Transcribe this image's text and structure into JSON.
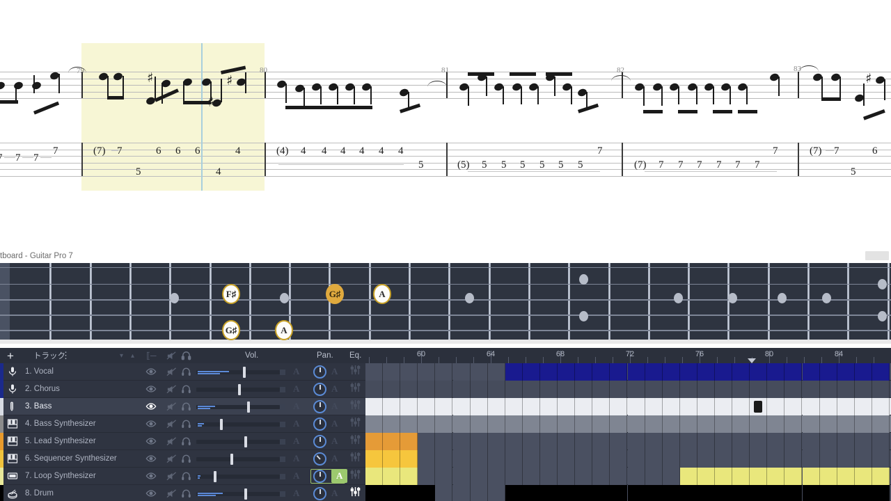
{
  "window": {
    "title": "tboard - Guitar Pro 7"
  },
  "score": {
    "measures": [
      {
        "number": "79",
        "tab_top": [
          "(7)",
          "7",
          "6",
          "6",
          "6",
          "4"
        ],
        "tab_low": [
          "5",
          "4"
        ],
        "selected": true
      },
      {
        "number": "80",
        "tab_top": [
          "(4)",
          "4",
          "4",
          "4",
          "4",
          "4",
          "4"
        ],
        "tab_low": [
          "5"
        ],
        "selected": false
      },
      {
        "number": "81",
        "tab_top": [
          "(5)",
          "5",
          "5",
          "5",
          "5",
          "5",
          "5",
          "7"
        ],
        "tab_low": [],
        "selected": false
      },
      {
        "number": "82",
        "tab_top": [
          "(7)",
          "7",
          "7",
          "7",
          "7",
          "7",
          "7",
          "7"
        ],
        "tab_low": [],
        "selected": false
      },
      {
        "number": "83",
        "tab_top": [
          "(7)",
          "7",
          "6"
        ],
        "tab_low": [
          "5"
        ],
        "selected": false
      }
    ],
    "partial_left_tab": [
      "7",
      "7",
      "7",
      "7"
    ]
  },
  "fretboard": {
    "notes": [
      {
        "label": "F♯",
        "style": "plain"
      },
      {
        "label": "G♯",
        "style": "root"
      },
      {
        "label": "A",
        "style": "plain"
      },
      {
        "label": "G♯",
        "style": "plain"
      },
      {
        "label": "A",
        "style": "plain"
      }
    ]
  },
  "track_panel": {
    "add_label": "+",
    "header_label": "トラック",
    "menu_icon": "kebab-menu-icon",
    "columns": {
      "vol": "Vol.",
      "pan": "Pan.",
      "eq": "Eq."
    },
    "tracks": [
      {
        "name": "1. Vocal",
        "icon": "microphone-icon",
        "color": "#1b2a8c",
        "selected": false,
        "vol": 0.6,
        "meter": 0.4,
        "pan_active": false,
        "eq_bright": false
      },
      {
        "name": "2. Chorus",
        "icon": "microphone-icon",
        "color": "#1b2a8c",
        "selected": false,
        "vol": 0.54,
        "meter": 0.0,
        "pan_active": false,
        "eq_bright": false
      },
      {
        "name": "3. Bass",
        "icon": "bass-guitar-icon",
        "color": "#d8dce4",
        "selected": true,
        "vol": 0.65,
        "meter": 0.22,
        "pan_active": false,
        "eq_bright": false
      },
      {
        "name": "4. Bass Synthesizer",
        "icon": "synth-icon",
        "color": "#8b8b8b",
        "selected": false,
        "vol": 0.3,
        "meter": 0.08,
        "pan_active": false,
        "eq_bright": false
      },
      {
        "name": "5. Lead Synthesizer",
        "icon": "synth-icon",
        "color": "#e89a2c",
        "selected": false,
        "vol": 0.62,
        "meter": 0.0,
        "pan_active": false,
        "eq_bright": false
      },
      {
        "name": "6. Sequencer Synthesizer",
        "icon": "synth-icon",
        "color": "#f0c33c",
        "selected": false,
        "vol": 0.44,
        "meter": 0.0,
        "pan_active": false,
        "eq_bright": false
      },
      {
        "name": "7. Loop Synthesizer",
        "icon": "loop-box-icon",
        "color": "#e8e89a",
        "selected": false,
        "vol": 0.22,
        "meter": 0.04,
        "pan_active": true,
        "eq_bright": false
      },
      {
        "name": "8. Drum",
        "icon": "drum-icon",
        "color": "#000000",
        "selected": false,
        "vol": 0.62,
        "meter": 0.32,
        "pan_active": false,
        "eq_bright": true
      }
    ],
    "automation_label": "A"
  },
  "timeline": {
    "ruler_numbers": [
      "60",
      "64",
      "68",
      "72",
      "76",
      "80",
      "84"
    ],
    "playhead_measure": "79",
    "lanes": [
      {
        "track": "1. Vocal",
        "clip_color": "#191a8f",
        "empty_color": "#4a5061",
        "clips": [
          {
            "start": 8,
            "end": 30
          }
        ]
      },
      {
        "track": "2. Chorus",
        "clip_color": "#4a5061",
        "empty_color": "#464c5c",
        "clips": []
      },
      {
        "track": "3. Bass",
        "clip_color": "#ebedf2",
        "empty_color": "#ebedf2",
        "clips": [
          {
            "start": 0,
            "end": 30
          }
        ],
        "marker_at": 22
      },
      {
        "track": "4. Bass Synthesizer",
        "clip_color": "#7f8592",
        "empty_color": "#7f8592",
        "clips": [
          {
            "start": 0,
            "end": 30
          }
        ]
      },
      {
        "track": "5. Lead Synthesizer",
        "clip_color": "#e59b37",
        "empty_color": "#4a5061",
        "clips": [
          {
            "start": 0,
            "end": 3
          }
        ]
      },
      {
        "track": "6. Sequencer Synthesizer",
        "clip_color": "#f6c63d",
        "empty_color": "#4a5061",
        "clips": [
          {
            "start": 0,
            "end": 3
          }
        ]
      },
      {
        "track": "7. Loop Synthesizer",
        "clip_color": "#e9e77c",
        "empty_color": "#4a5061",
        "clips": [
          {
            "start": 0,
            "end": 3
          },
          {
            "start": 18,
            "end": 30
          }
        ]
      },
      {
        "track": "8. Drum",
        "clip_color": "#000000",
        "empty_color": "#4a5061",
        "clips": [
          {
            "start": 0,
            "end": 4
          },
          {
            "start": 8,
            "end": 30
          }
        ]
      }
    ]
  },
  "colors": {
    "panel_bg": "#2f3441",
    "header_bg": "#2b303c",
    "fretboard_bg": "#2e3440",
    "selection_yellow": "#f7f6d5",
    "playhead_blue": "#a8cfdd",
    "accent_green": "#9cc96e",
    "note_gold": "#e0aa3e"
  }
}
